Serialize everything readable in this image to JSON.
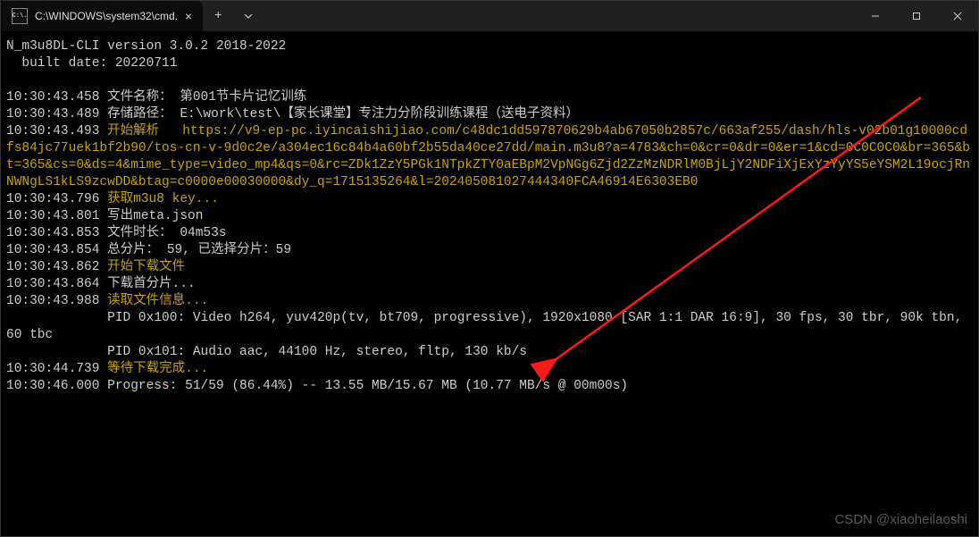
{
  "titlebar": {
    "tab_icon_text": "C:\\.",
    "tab_title": "C:\\WINDOWS\\system32\\cmd.",
    "close": "×",
    "new_tab": "+"
  },
  "header": {
    "line1": "N_m3u8DL-CLI version 3.0.2 2018-2022",
    "line2": "  built date: 20220711"
  },
  "lines": {
    "t1": "10:30:43.458",
    "l1a": "文件名称：",
    "l1b": "第001节卡片记忆训练",
    "t2": "10:30:43.489",
    "l2a": "存储路径：",
    "l2b": "E:\\work\\test\\【家长课堂】专注力分阶段训练课程（送电子资料）",
    "t3": "10:30:43.493",
    "l3a": "开始解析   ",
    "l3b": "https://v9-ep-pc.iyincaishijiao.com/c48dc1dd597870629b4ab67050b2857c/663af255/dash/hls-v02b01g10000cdfs84jc77uek1bf2b90/tos-cn-v-9d0c2e/a304ec16c84b4a60bf2b55da40ce27dd/main.m3u8?a=4783&ch=0&cr=0&dr=0&er=1&cd=0C0C0C0&br=365&bt=365&cs=0&ds=4&mime_type=video_mp4&qs=0&rc=ZDk1ZzY5PGk1NTpkZTY0aEBpM2VpNGg6Zjd2ZzMzNDRlM0BjLjY2NDFiXjExYzYyYS5eYSM2L19ocjRnNWNgLS1kLS9zcwDD&btag=c0000e00030000&dy_q=1715135264&l=202405081027444340FCA46914E6303EB0",
    "t4": "10:30:43.796",
    "l4a": "获取m3u8 key...",
    "t5": "10:30:43.801",
    "l5a": "写出meta.json",
    "t6": "10:30:43.853",
    "l6a": "文件时长：",
    "l6b": "04m53s",
    "t7": "10:30:43.854",
    "l7a": "总分片：",
    "l7b": "59, 已选择分片：59",
    "t8": "10:30:43.862",
    "l8a": "开始下载文件",
    "t9": "10:30:43.864",
    "l9a": "下载首分片...",
    "t10": "10:30:43.988",
    "l10a": "读取文件信息...",
    "vid": "             PID 0x100: Video h264, yuv420p(tv, bt709, progressive), 1920x1080 [SAR 1:1 DAR 16:9], 30 fps, 30 tbr, 90k tbn, 60 tbc",
    "aud": "             PID 0x101: Audio aac, 44100 Hz, stereo, fltp, 130 kb/s",
    "t11": "10:30:44.739",
    "l11a": "等待下载完成...",
    "t12": "10:30:46.000",
    "l12a": "Progress: 51/59 (86.44%) -- 13.55 MB/15.67 MB (10.77 MB/s @ 00m00s)"
  },
  "watermark": "CSDN @xiaoheilaoshi"
}
